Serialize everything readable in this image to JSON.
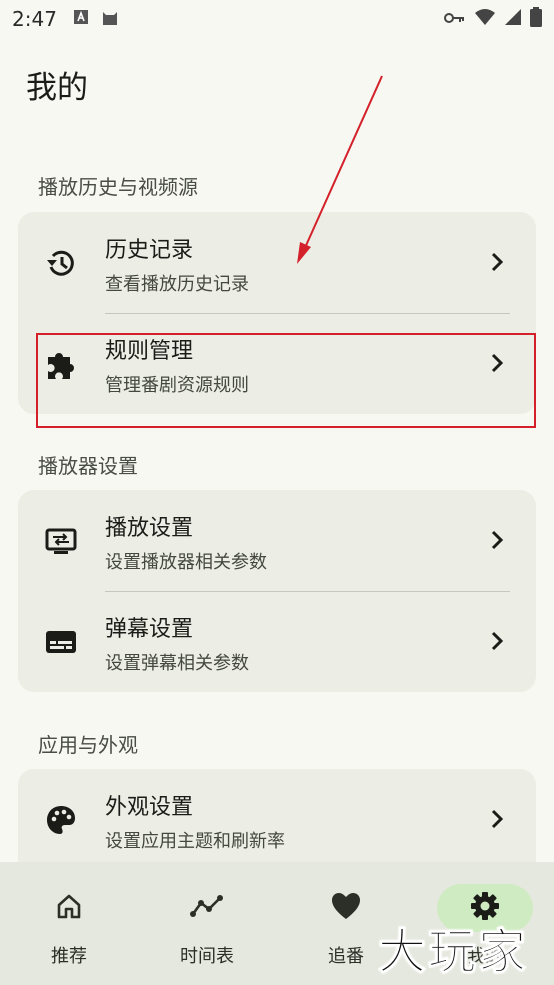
{
  "status_bar": {
    "time": "2:47",
    "icons": [
      "font-app-icon",
      "cat-app-icon",
      "key-icon",
      "wifi-icon",
      "signal-icon",
      "battery-icon"
    ]
  },
  "page": {
    "title": "我的"
  },
  "sections": [
    {
      "header": "播放历史与视频源",
      "items": [
        {
          "icon": "history-icon",
          "title": "历史记录",
          "subtitle": "查看播放历史记录"
        },
        {
          "icon": "puzzle-icon",
          "title": "规则管理",
          "subtitle": "管理番剧资源规则"
        }
      ]
    },
    {
      "header": "播放器设置",
      "items": [
        {
          "icon": "player-settings-icon",
          "title": "播放设置",
          "subtitle": "设置播放器相关参数"
        },
        {
          "icon": "subtitles-icon",
          "title": "弹幕设置",
          "subtitle": "设置弹幕相关参数"
        }
      ]
    },
    {
      "header": "应用与外观",
      "items": [
        {
          "icon": "palette-icon",
          "title": "外观设置",
          "subtitle": "设置应用主题和刷新率"
        }
      ]
    }
  ],
  "bottom_nav": [
    {
      "icon": "home-icon",
      "label": "推荐",
      "active": false
    },
    {
      "icon": "timeline-icon",
      "label": "时间表",
      "active": false
    },
    {
      "icon": "heart-icon",
      "label": "追番",
      "active": false
    },
    {
      "icon": "gear-icon",
      "label": "我的",
      "active": true
    }
  ],
  "watermark": "大玩家",
  "colors": {
    "background": "#f7f8f1",
    "card": "#eceee5",
    "nav_bar": "#e5e8de",
    "nav_active_pill": "#cfebc2",
    "annotation_red": "#d4202a"
  }
}
